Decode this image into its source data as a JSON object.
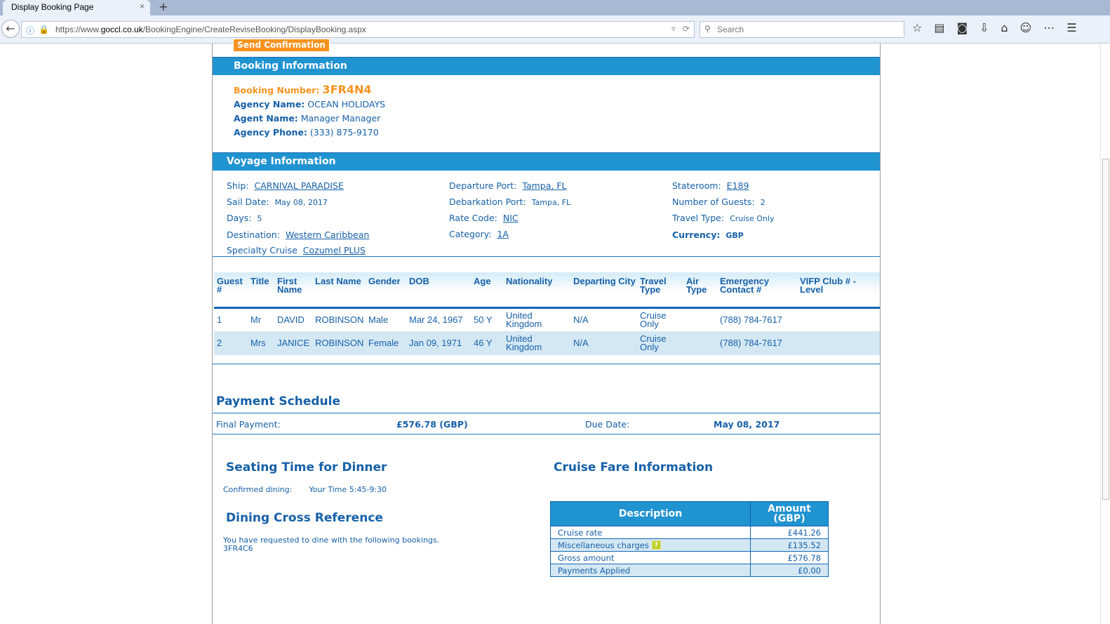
{
  "browser": {
    "tab_title": "Display Booking Page",
    "tab_close": "×",
    "new_tab": "+",
    "url_prefix": "https://www.",
    "url_domain": "goccl.co.uk",
    "url_path": "/BookingEngine/CreateReviseBooking/DisplayBooking.aspx",
    "search_placeholder": "Search"
  },
  "send_confirmation": "Send Confirmation",
  "booking": {
    "header": "Booking Information",
    "number_label": "Booking Number:",
    "number": "3FR4N4",
    "agency_label": "Agency Name:",
    "agency": "OCEAN HOLIDAYS",
    "agent_label": "Agent Name:",
    "agent": "Manager Manager",
    "phone_label": "Agency Phone:",
    "phone": "(333) 875-9170"
  },
  "voyage": {
    "header": "Voyage Information",
    "col1": [
      {
        "label": "Ship:",
        "value": "CARNIVAL PARADISE",
        "link": true
      },
      {
        "label": "Sail Date:",
        "value": "May 08, 2017"
      },
      {
        "label": "Days:",
        "value": "5"
      },
      {
        "label": "Destination:",
        "value": "Western Caribbean",
        "link": true
      },
      {
        "label": "Specialty Cruise",
        "value": "Cozumel PLUS",
        "link": true
      }
    ],
    "col2": [
      {
        "label": "Departure Port:",
        "value": "Tampa, FL",
        "link": true
      },
      {
        "label": "Debarkation Port:",
        "value": "Tampa, FL"
      },
      {
        "label": "Rate Code:",
        "value": "NIC",
        "link": true
      },
      {
        "label": "Category:",
        "value": "1A",
        "link": true
      }
    ],
    "col3": [
      {
        "label": "Stateroom:",
        "value": "E189",
        "link": true
      },
      {
        "label": "Number of Guests:",
        "value": "2"
      },
      {
        "label": "Travel Type:",
        "value": "Cruise Only"
      },
      {
        "label": "Currency:",
        "value": "GBP",
        "bold": true
      }
    ]
  },
  "guests": {
    "headers": [
      "Guest #",
      "Title",
      "First Name",
      "Last Name",
      "Gender",
      "DOB",
      "Age",
      "Nationality",
      "Departing City",
      "Travel Type",
      "Air Type",
      "Emergency Contact #",
      "VIFP Club # - Level"
    ],
    "rows": [
      [
        "1",
        "Mr",
        "DAVID",
        "ROBINSON",
        "Male",
        "Mar 24, 1967",
        "50 Y",
        "United Kingdom",
        "N/A",
        "Cruise Only",
        "",
        "(788) 784-7617",
        ""
      ],
      [
        "2",
        "Mrs",
        "JANICE",
        "ROBINSON",
        "Female",
        "Jan 09, 1971",
        "46 Y",
        "United Kingdom",
        "N/A",
        "Cruise Only",
        "",
        "(788) 784-7617",
        ""
      ]
    ]
  },
  "payment": {
    "title": "Payment Schedule",
    "final_label": "Final Payment:",
    "final_value": "£576.78 (GBP)",
    "due_label": "Due Date:",
    "due_value": "May 08, 2017"
  },
  "dining": {
    "title": "Seating Time for Dinner",
    "confirmed_label": "Confirmed dining:",
    "confirmed_value": "Your Time 5:45-9:30",
    "xref_title": "Dining Cross Reference",
    "xref_text": "You have requested to dine with the following bookings.",
    "xref_booking": "3FR4C6"
  },
  "fare": {
    "title": "Cruise Fare Information",
    "col_desc": "Description",
    "col_amt": "Amount (GBP)",
    "help": "?",
    "rows": [
      {
        "desc": "Cruise rate",
        "amt": "£441.26"
      },
      {
        "desc": "Miscellaneous charges",
        "amt": "£135.52",
        "help": true
      },
      {
        "desc": "Gross amount",
        "amt": "£576.78"
      },
      {
        "desc": "Payments Applied",
        "amt": "£0.00"
      }
    ]
  }
}
